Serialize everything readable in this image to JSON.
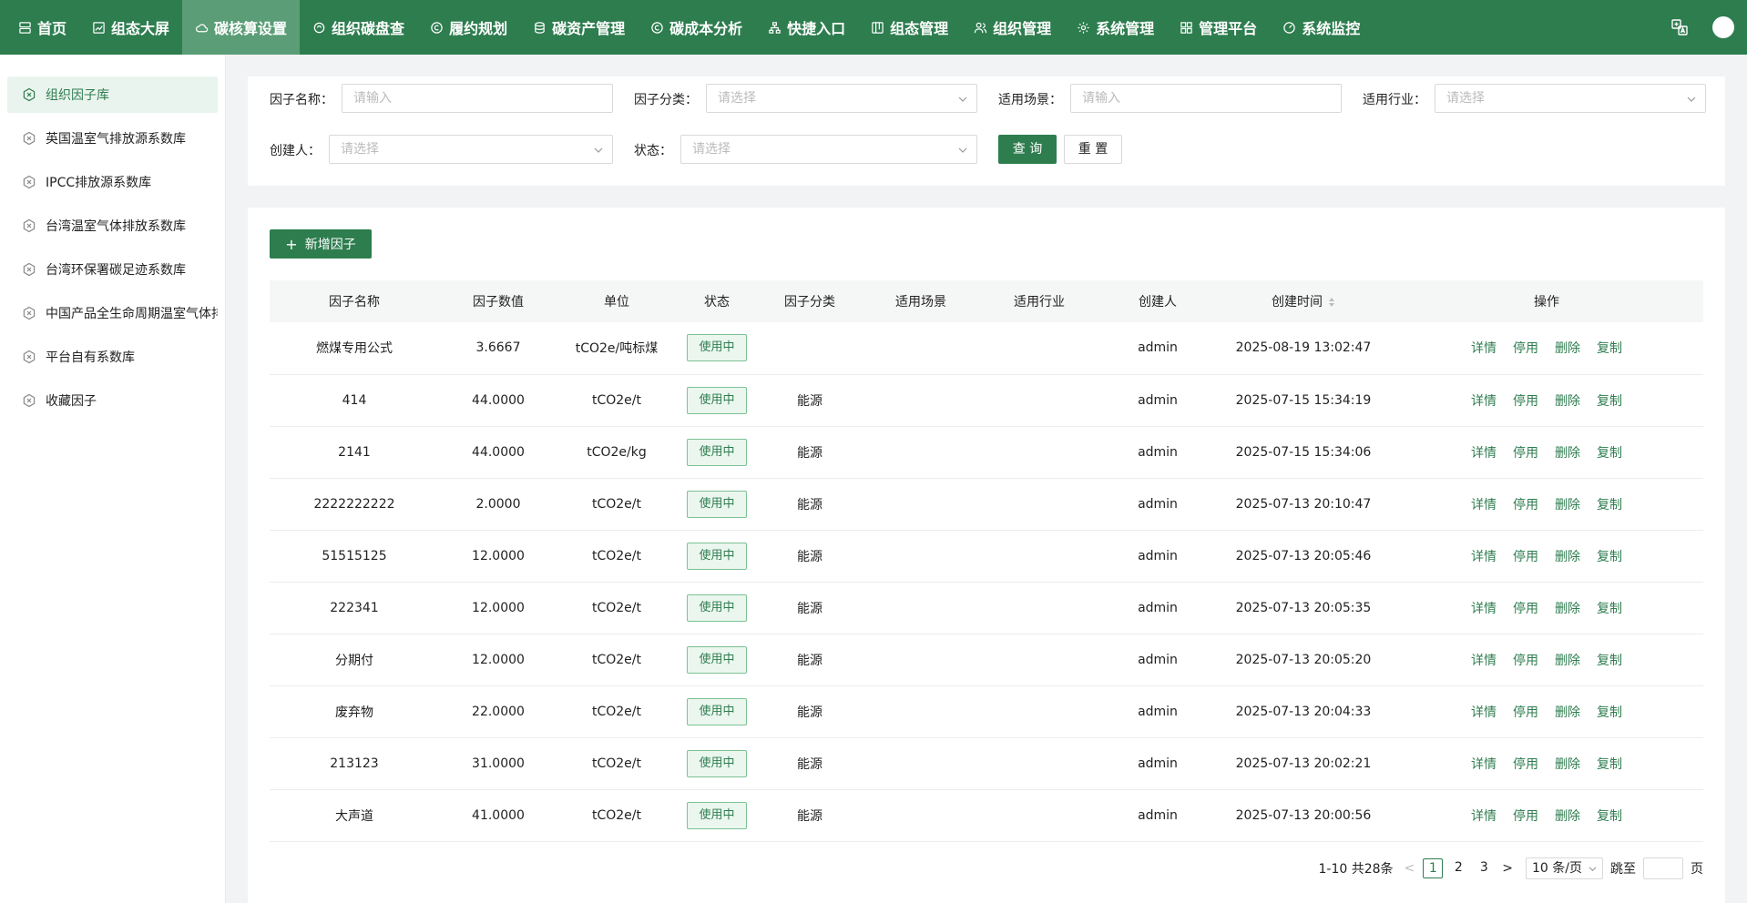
{
  "nav": {
    "items": [
      {
        "label": "首页",
        "icon": "server-icon"
      },
      {
        "label": "组态大屏",
        "icon": "chart-line-icon"
      },
      {
        "label": "碳核算设置",
        "icon": "cloud-icon"
      },
      {
        "label": "组织碳盘查",
        "icon": "search-icon"
      },
      {
        "label": "履约规划",
        "icon": "c-circle-icon"
      },
      {
        "label": "碳资产管理",
        "icon": "database-icon"
      },
      {
        "label": "碳成本分析",
        "icon": "c-circle-icon"
      },
      {
        "label": "快捷入口",
        "icon": "sitemap-icon"
      },
      {
        "label": "组态管理",
        "icon": "layout-icon"
      },
      {
        "label": "组织管理",
        "icon": "users-icon"
      },
      {
        "label": "系统管理",
        "icon": "gear-icon"
      },
      {
        "label": "管理平台",
        "icon": "grid-icon"
      },
      {
        "label": "系统监控",
        "icon": "gauge-icon"
      }
    ],
    "active_index": 2,
    "accent": "#2e7d4f"
  },
  "sidebar": {
    "items": [
      {
        "label": "组织因子库"
      },
      {
        "label": "英国温室气排放源系数库"
      },
      {
        "label": "IPCC排放源系数库"
      },
      {
        "label": "台湾温室气体排放系数库"
      },
      {
        "label": "台湾环保署碳足迹系数库"
      },
      {
        "label": "中国产品全生命周期温室气体排放系数库"
      },
      {
        "label": "平台自有系数库"
      },
      {
        "label": "收藏因子"
      }
    ],
    "active_index": 0
  },
  "filter": {
    "factor_name": {
      "label": "因子名称：",
      "placeholder": "请输入"
    },
    "factor_category": {
      "label": "因子分类：",
      "placeholder": "请选择"
    },
    "scene": {
      "label": "适用场景：",
      "placeholder": "请输入"
    },
    "industry": {
      "label": "适用行业：",
      "placeholder": "请选择"
    },
    "creator": {
      "label": "创建人：",
      "placeholder": "请选择"
    },
    "status": {
      "label": "状态：",
      "placeholder": "请选择"
    },
    "query_label": "查 询",
    "reset_label": "重 置"
  },
  "table": {
    "add_label": "新增因子",
    "columns": [
      "因子名称",
      "因子数值",
      "单位",
      "状态",
      "因子分类",
      "适用场景",
      "适用行业",
      "创建人",
      "创建时间",
      "操作"
    ],
    "actions": [
      "详情",
      "停用",
      "删除",
      "复制"
    ],
    "rows": [
      {
        "name": "燃煤专用公式",
        "value": "3.6667",
        "unit": "tCO2e/吨标煤",
        "status": "使用中",
        "category": "",
        "scene": "",
        "industry": "",
        "creator": "admin",
        "created": "2025-08-19 13:02:47"
      },
      {
        "name": "414",
        "value": "44.0000",
        "unit": "tCO2e/t",
        "status": "使用中",
        "category": "能源",
        "scene": "",
        "industry": "",
        "creator": "admin",
        "created": "2025-07-15 15:34:19"
      },
      {
        "name": "2141",
        "value": "44.0000",
        "unit": "tCO2e/kg",
        "status": "使用中",
        "category": "能源",
        "scene": "",
        "industry": "",
        "creator": "admin",
        "created": "2025-07-15 15:34:06"
      },
      {
        "name": "2222222222",
        "value": "2.0000",
        "unit": "tCO2e/t",
        "status": "使用中",
        "category": "能源",
        "scene": "",
        "industry": "",
        "creator": "admin",
        "created": "2025-07-13 20:10:47"
      },
      {
        "name": "51515125",
        "value": "12.0000",
        "unit": "tCO2e/t",
        "status": "使用中",
        "category": "能源",
        "scene": "",
        "industry": "",
        "creator": "admin",
        "created": "2025-07-13 20:05:46"
      },
      {
        "name": "222341",
        "value": "12.0000",
        "unit": "tCO2e/t",
        "status": "使用中",
        "category": "能源",
        "scene": "",
        "industry": "",
        "creator": "admin",
        "created": "2025-07-13 20:05:35"
      },
      {
        "name": "分期付",
        "value": "12.0000",
        "unit": "tCO2e/t",
        "status": "使用中",
        "category": "能源",
        "scene": "",
        "industry": "",
        "creator": "admin",
        "created": "2025-07-13 20:05:20"
      },
      {
        "name": "废弃物",
        "value": "22.0000",
        "unit": "tCO2e/t",
        "status": "使用中",
        "category": "能源",
        "scene": "",
        "industry": "",
        "creator": "admin",
        "created": "2025-07-13 20:04:33"
      },
      {
        "name": "213123",
        "value": "31.0000",
        "unit": "tCO2e/t",
        "status": "使用中",
        "category": "能源",
        "scene": "",
        "industry": "",
        "creator": "admin",
        "created": "2025-07-13 20:02:21"
      },
      {
        "name": "大声道",
        "value": "41.0000",
        "unit": "tCO2e/t",
        "status": "使用中",
        "category": "能源",
        "scene": "",
        "industry": "",
        "creator": "admin",
        "created": "2025-07-13 20:00:56"
      }
    ]
  },
  "pagination": {
    "summary": "1-10 共28条",
    "pages": [
      "1",
      "2",
      "3"
    ],
    "current": "1",
    "page_size": "10 条/页",
    "jump_label": "跳至",
    "page_suffix": "页"
  }
}
